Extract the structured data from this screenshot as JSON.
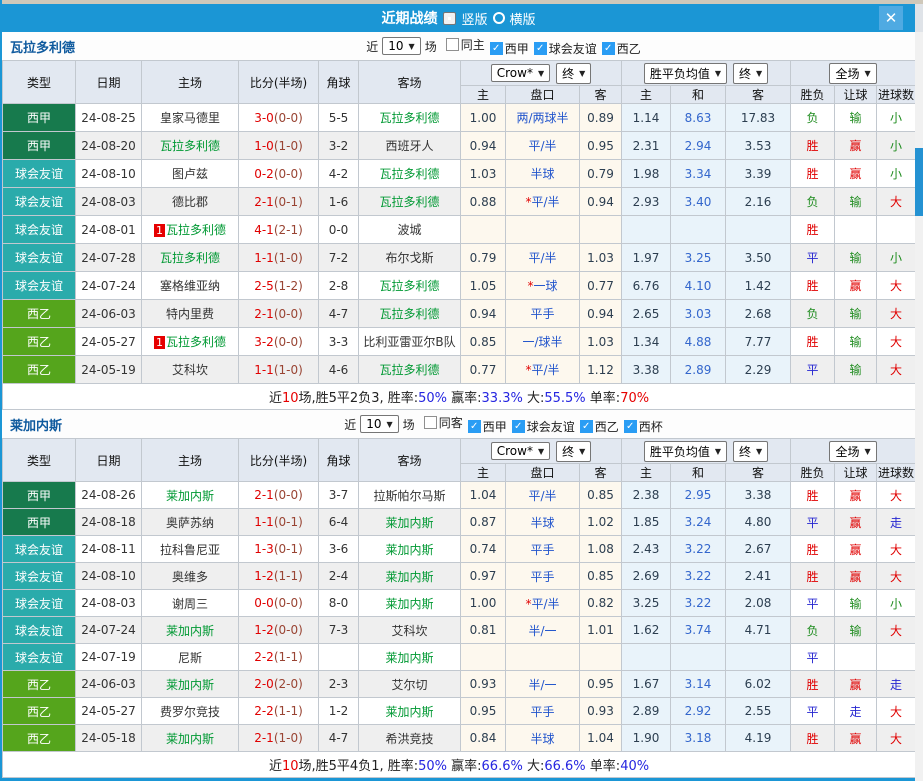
{
  "icons": {
    "check": "✓",
    "caret": "▼",
    "close": "✕"
  },
  "colors": {
    "titlebar_blue": "#1b96d5",
    "laliga_badge": "#177a4d",
    "friendly_badge": "#2aabab",
    "segunda_badge": "#55a51c",
    "focus_team_green": "#009933",
    "win_red": "#e00000",
    "lose_green": "#1f8c1f",
    "draw_blue": "#2525d0"
  },
  "titlebar": {
    "title": "近期战绩",
    "portrait": "竖版",
    "landscape": "横版"
  },
  "headers": {
    "main": [
      "类型",
      "日期",
      "主场",
      "比分(半场)",
      "角球",
      "客场"
    ],
    "sub": [
      "主",
      "盘口",
      "客",
      "主",
      "和",
      "客",
      "胜负",
      "让球",
      "进球数"
    ],
    "controls": {
      "source": "Crow*",
      "source_time": "终",
      "avg": "胜平负均值",
      "avg_time": "终",
      "scope": "全场"
    }
  },
  "sections": [
    {
      "team": "瓦拉多利德",
      "filter": {
        "near_label": "近",
        "count": "10",
        "unit_label": "场",
        "checks": [
          {
            "label": "同主",
            "on": false
          },
          {
            "label": "西甲",
            "on": true
          },
          {
            "label": "球会友谊",
            "on": true
          },
          {
            "label": "西乙",
            "on": true
          }
        ]
      },
      "rows": [
        {
          "type": "西甲",
          "tc": "lg",
          "date": "24-08-25",
          "home": "皇家马德里",
          "hfocus": false,
          "hbadge": "",
          "score": "3-0",
          "half": "(0-0)",
          "corner": "5-5",
          "away": "瓦拉多利德",
          "afocus": true,
          "o1": "1.00",
          "star": "",
          "hcap": "两/两球半",
          "o2": "0.89",
          "a1": "1.14",
          "a2": "8.63",
          "a3": "17.83",
          "res": [
            {
              "t": "负",
              "c": "g"
            },
            {
              "t": "输",
              "c": "g"
            },
            {
              "t": "小",
              "c": "g"
            }
          ]
        },
        {
          "type": "西甲",
          "tc": "lg",
          "date": "24-08-20",
          "home": "瓦拉多利德",
          "hfocus": true,
          "hbadge": "",
          "score": "1-0",
          "half": "(1-0)",
          "corner": "3-2",
          "away": "西班牙人",
          "afocus": false,
          "o1": "0.94",
          "star": "",
          "hcap": "平/半",
          "o2": "0.95",
          "a1": "2.31",
          "a2": "2.94",
          "a3": "3.53",
          "res": [
            {
              "t": "胜",
              "c": "r"
            },
            {
              "t": "赢",
              "c": "r"
            },
            {
              "t": "小",
              "c": "g"
            }
          ]
        },
        {
          "type": "球会友谊",
          "tc": "fr",
          "date": "24-08-10",
          "home": "图卢兹",
          "hfocus": false,
          "hbadge": "",
          "score": "0-2",
          "half": "(0-0)",
          "corner": "4-2",
          "away": "瓦拉多利德",
          "afocus": true,
          "o1": "1.03",
          "star": "",
          "hcap": "半球",
          "o2": "0.79",
          "a1": "1.98",
          "a2": "3.34",
          "a3": "3.39",
          "res": [
            {
              "t": "胜",
              "c": "r"
            },
            {
              "t": "赢",
              "c": "r"
            },
            {
              "t": "小",
              "c": "g"
            }
          ]
        },
        {
          "type": "球会友谊",
          "tc": "fr",
          "date": "24-08-03",
          "home": "德比郡",
          "hfocus": false,
          "hbadge": "",
          "score": "2-1",
          "half": "(0-1)",
          "corner": "1-6",
          "away": "瓦拉多利德",
          "afocus": true,
          "o1": "0.88",
          "star": "*",
          "hcap": "平/半",
          "o2": "0.94",
          "a1": "2.93",
          "a2": "3.40",
          "a3": "2.16",
          "res": [
            {
              "t": "负",
              "c": "g"
            },
            {
              "t": "输",
              "c": "g"
            },
            {
              "t": "大",
              "c": "r"
            }
          ]
        },
        {
          "type": "球会友谊",
          "tc": "fr",
          "date": "24-08-01",
          "home": "瓦拉多利德",
          "hfocus": true,
          "hbadge": "1",
          "score": "4-1",
          "half": "(2-1)",
          "corner": "0-0",
          "away": "波城",
          "afocus": false,
          "o1": "",
          "star": "",
          "hcap": "",
          "o2": "",
          "a1": "",
          "a2": "",
          "a3": "",
          "res": [
            {
              "t": "胜",
              "c": "r"
            },
            {
              "t": "",
              "c": ""
            },
            {
              "t": "",
              "c": ""
            }
          ]
        },
        {
          "type": "球会友谊",
          "tc": "fr",
          "date": "24-07-28",
          "home": "瓦拉多利德",
          "hfocus": true,
          "hbadge": "",
          "score": "1-1",
          "half": "(1-0)",
          "corner": "7-2",
          "away": "布尔戈斯",
          "afocus": false,
          "o1": "0.79",
          "star": "",
          "hcap": "平/半",
          "o2": "1.03",
          "a1": "1.97",
          "a2": "3.25",
          "a3": "3.50",
          "res": [
            {
              "t": "平",
              "c": "b"
            },
            {
              "t": "输",
              "c": "g"
            },
            {
              "t": "小",
              "c": "g"
            }
          ]
        },
        {
          "type": "球会友谊",
          "tc": "fr",
          "date": "24-07-24",
          "home": "塞格维亚纳",
          "hfocus": false,
          "hbadge": "",
          "score": "2-5",
          "half": "(1-2)",
          "corner": "2-8",
          "away": "瓦拉多利德",
          "afocus": true,
          "o1": "1.05",
          "star": "*",
          "hcap": "一球",
          "o2": "0.77",
          "a1": "6.76",
          "a2": "4.10",
          "a3": "1.42",
          "res": [
            {
              "t": "胜",
              "c": "r"
            },
            {
              "t": "赢",
              "c": "r"
            },
            {
              "t": "大",
              "c": "r"
            }
          ]
        },
        {
          "type": "西乙",
          "tc": "se",
          "date": "24-06-03",
          "home": "特内里费",
          "hfocus": false,
          "hbadge": "",
          "score": "2-1",
          "half": "(0-0)",
          "corner": "4-7",
          "away": "瓦拉多利德",
          "afocus": true,
          "o1": "0.94",
          "star": "",
          "hcap": "平手",
          "o2": "0.94",
          "a1": "2.65",
          "a2": "3.03",
          "a3": "2.68",
          "res": [
            {
              "t": "负",
              "c": "g"
            },
            {
              "t": "输",
              "c": "g"
            },
            {
              "t": "大",
              "c": "r"
            }
          ]
        },
        {
          "type": "西乙",
          "tc": "se",
          "date": "24-05-27",
          "home": "瓦拉多利德",
          "hfocus": true,
          "hbadge": "1",
          "score": "3-2",
          "half": "(0-0)",
          "corner": "3-3",
          "away": "比利亚雷亚尔B队",
          "afocus": false,
          "o1": "0.85",
          "star": "",
          "hcap": "一/球半",
          "o2": "1.03",
          "a1": "1.34",
          "a2": "4.88",
          "a3": "7.77",
          "res": [
            {
              "t": "胜",
              "c": "r"
            },
            {
              "t": "输",
              "c": "g"
            },
            {
              "t": "大",
              "c": "r"
            }
          ]
        },
        {
          "type": "西乙",
          "tc": "se",
          "date": "24-05-19",
          "home": "艾科坎",
          "hfocus": false,
          "hbadge": "",
          "score": "1-1",
          "half": "(1-0)",
          "corner": "4-6",
          "away": "瓦拉多利德",
          "afocus": true,
          "o1": "0.77",
          "star": "*",
          "hcap": "平/半",
          "o2": "1.12",
          "a1": "3.38",
          "a2": "2.89",
          "a3": "2.29",
          "res": [
            {
              "t": "平",
              "c": "b"
            },
            {
              "t": "输",
              "c": "g"
            },
            {
              "t": "大",
              "c": "r"
            }
          ]
        }
      ],
      "footer": [
        {
          "t": "近",
          "c": "k"
        },
        {
          "t": "10",
          "c": "red"
        },
        {
          "t": "场,胜5平2负3, 胜率:",
          "c": "k"
        },
        {
          "t": "50%",
          "c": "blue"
        },
        {
          "t": " 赢率:",
          "c": "k"
        },
        {
          "t": "33.3%",
          "c": "blue"
        },
        {
          "t": " 大:",
          "c": "k"
        },
        {
          "t": "55.5%",
          "c": "blue"
        },
        {
          "t": " 单率:",
          "c": "k"
        },
        {
          "t": "70%",
          "c": "red"
        }
      ]
    },
    {
      "team": "莱加内斯",
      "filter": {
        "near_label": "近",
        "count": "10",
        "unit_label": "场",
        "checks": [
          {
            "label": "同客",
            "on": false
          },
          {
            "label": "西甲",
            "on": true
          },
          {
            "label": "球会友谊",
            "on": true
          },
          {
            "label": "西乙",
            "on": true
          },
          {
            "label": "西杯",
            "on": true
          }
        ]
      },
      "rows": [
        {
          "type": "西甲",
          "tc": "lg",
          "date": "24-08-26",
          "home": "莱加内斯",
          "hfocus": true,
          "hbadge": "",
          "score": "2-1",
          "half": "(0-0)",
          "corner": "3-7",
          "away": "拉斯帕尔马斯",
          "afocus": false,
          "o1": "1.04",
          "star": "",
          "hcap": "平/半",
          "o2": "0.85",
          "a1": "2.38",
          "a2": "2.95",
          "a3": "3.38",
          "res": [
            {
              "t": "胜",
              "c": "r"
            },
            {
              "t": "赢",
              "c": "r"
            },
            {
              "t": "大",
              "c": "r"
            }
          ]
        },
        {
          "type": "西甲",
          "tc": "lg",
          "date": "24-08-18",
          "home": "奥萨苏纳",
          "hfocus": false,
          "hbadge": "",
          "score": "1-1",
          "half": "(0-1)",
          "corner": "6-4",
          "away": "莱加内斯",
          "afocus": true,
          "o1": "0.87",
          "star": "",
          "hcap": "半球",
          "o2": "1.02",
          "a1": "1.85",
          "a2": "3.24",
          "a3": "4.80",
          "res": [
            {
              "t": "平",
              "c": "b"
            },
            {
              "t": "赢",
              "c": "r"
            },
            {
              "t": "走",
              "c": "b"
            }
          ]
        },
        {
          "type": "球会友谊",
          "tc": "fr",
          "date": "24-08-11",
          "home": "拉科鲁尼亚",
          "hfocus": false,
          "hbadge": "",
          "score": "1-3",
          "half": "(0-1)",
          "corner": "3-6",
          "away": "莱加内斯",
          "afocus": true,
          "o1": "0.74",
          "star": "",
          "hcap": "平手",
          "o2": "1.08",
          "a1": "2.43",
          "a2": "3.22",
          "a3": "2.67",
          "res": [
            {
              "t": "胜",
              "c": "r"
            },
            {
              "t": "赢",
              "c": "r"
            },
            {
              "t": "大",
              "c": "r"
            }
          ]
        },
        {
          "type": "球会友谊",
          "tc": "fr",
          "date": "24-08-10",
          "home": "奥维多",
          "hfocus": false,
          "hbadge": "",
          "score": "1-2",
          "half": "(1-1)",
          "corner": "2-4",
          "away": "莱加内斯",
          "afocus": true,
          "o1": "0.97",
          "star": "",
          "hcap": "平手",
          "o2": "0.85",
          "a1": "2.69",
          "a2": "3.22",
          "a3": "2.41",
          "res": [
            {
              "t": "胜",
              "c": "r"
            },
            {
              "t": "赢",
              "c": "r"
            },
            {
              "t": "大",
              "c": "r"
            }
          ]
        },
        {
          "type": "球会友谊",
          "tc": "fr",
          "date": "24-08-03",
          "home": "谢周三",
          "hfocus": false,
          "hbadge": "",
          "score": "0-0",
          "half": "(0-0)",
          "corner": "8-0",
          "away": "莱加内斯",
          "afocus": true,
          "o1": "1.00",
          "star": "*",
          "hcap": "平/半",
          "o2": "0.82",
          "a1": "3.25",
          "a2": "3.22",
          "a3": "2.08",
          "res": [
            {
              "t": "平",
              "c": "b"
            },
            {
              "t": "输",
              "c": "g"
            },
            {
              "t": "小",
              "c": "g"
            }
          ]
        },
        {
          "type": "球会友谊",
          "tc": "fr",
          "date": "24-07-24",
          "home": "莱加内斯",
          "hfocus": true,
          "hbadge": "",
          "score": "1-2",
          "half": "(0-0)",
          "corner": "7-3",
          "away": "艾科坎",
          "afocus": false,
          "o1": "0.81",
          "star": "",
          "hcap": "半/一",
          "o2": "1.01",
          "a1": "1.62",
          "a2": "3.74",
          "a3": "4.71",
          "res": [
            {
              "t": "负",
              "c": "g"
            },
            {
              "t": "输",
              "c": "g"
            },
            {
              "t": "大",
              "c": "r"
            }
          ]
        },
        {
          "type": "球会友谊",
          "tc": "fr",
          "date": "24-07-19",
          "home": "尼斯",
          "hfocus": false,
          "hbadge": "",
          "score": "2-2",
          "half": "(1-1)",
          "corner": "",
          "away": "莱加内斯",
          "afocus": true,
          "o1": "",
          "star": "",
          "hcap": "",
          "o2": "",
          "a1": "",
          "a2": "",
          "a3": "",
          "res": [
            {
              "t": "平",
              "c": "b"
            },
            {
              "t": "",
              "c": ""
            },
            {
              "t": "",
              "c": ""
            }
          ]
        },
        {
          "type": "西乙",
          "tc": "se",
          "date": "24-06-03",
          "home": "莱加内斯",
          "hfocus": true,
          "hbadge": "",
          "score": "2-0",
          "half": "(2-0)",
          "corner": "2-3",
          "away": "艾尔切",
          "afocus": false,
          "o1": "0.93",
          "star": "",
          "hcap": "半/一",
          "o2": "0.95",
          "a1": "1.67",
          "a2": "3.14",
          "a3": "6.02",
          "res": [
            {
              "t": "胜",
              "c": "r"
            },
            {
              "t": "赢",
              "c": "r"
            },
            {
              "t": "走",
              "c": "b"
            }
          ]
        },
        {
          "type": "西乙",
          "tc": "se",
          "date": "24-05-27",
          "home": "费罗尔竞技",
          "hfocus": false,
          "hbadge": "",
          "score": "2-2",
          "half": "(1-1)",
          "corner": "1-2",
          "away": "莱加内斯",
          "afocus": true,
          "o1": "0.95",
          "star": "",
          "hcap": "平手",
          "o2": "0.93",
          "a1": "2.89",
          "a2": "2.92",
          "a3": "2.55",
          "res": [
            {
              "t": "平",
              "c": "b"
            },
            {
              "t": "走",
              "c": "b"
            },
            {
              "t": "大",
              "c": "r"
            }
          ]
        },
        {
          "type": "西乙",
          "tc": "se",
          "date": "24-05-18",
          "home": "莱加内斯",
          "hfocus": true,
          "hbadge": "",
          "score": "2-1",
          "half": "(1-0)",
          "corner": "4-7",
          "away": "希洪竞技",
          "afocus": false,
          "o1": "0.84",
          "star": "",
          "hcap": "半球",
          "o2": "1.04",
          "a1": "1.90",
          "a2": "3.18",
          "a3": "4.19",
          "res": [
            {
              "t": "胜",
              "c": "r"
            },
            {
              "t": "赢",
              "c": "r"
            },
            {
              "t": "大",
              "c": "r"
            }
          ]
        }
      ],
      "footer": [
        {
          "t": "近",
          "c": "k"
        },
        {
          "t": "10",
          "c": "red"
        },
        {
          "t": "场,胜5平4负1, 胜率:",
          "c": "k"
        },
        {
          "t": "50%",
          "c": "blue"
        },
        {
          "t": " 赢率:",
          "c": "k"
        },
        {
          "t": "66.6%",
          "c": "blue"
        },
        {
          "t": " 大:",
          "c": "k"
        },
        {
          "t": "66.6%",
          "c": "blue"
        },
        {
          "t": " 单率:",
          "c": "k"
        },
        {
          "t": "40%",
          "c": "blue"
        }
      ]
    }
  ]
}
